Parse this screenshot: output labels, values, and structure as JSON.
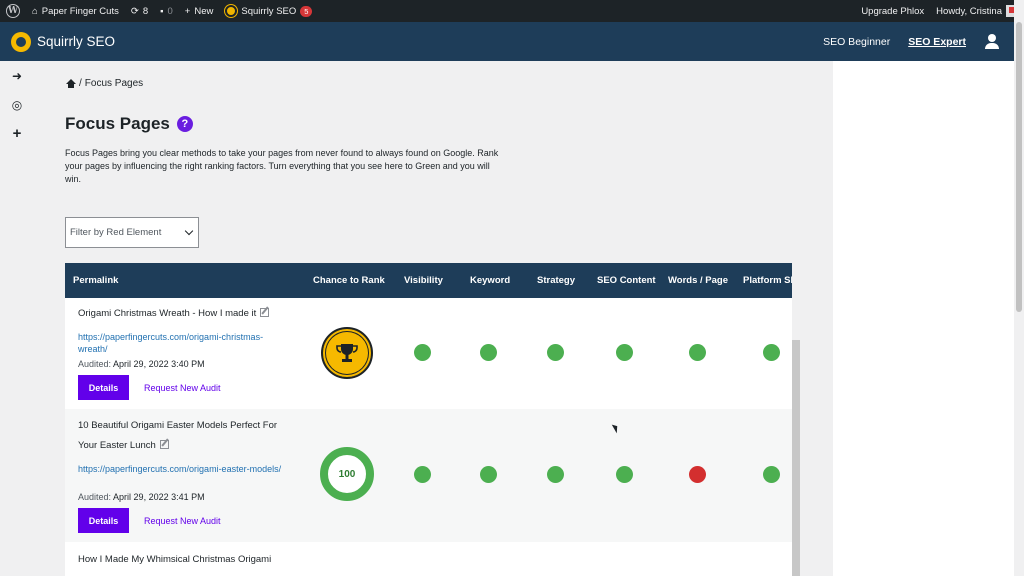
{
  "adminbar": {
    "site_name": "Paper Finger Cuts",
    "updates_count": "8",
    "comments_count": "0",
    "new_label": "New",
    "squirrly_label": "Squirrly SEO",
    "squirrly_badge": "5",
    "upgrade_label": "Upgrade Phlox",
    "howdy_label": "Howdy, Cristina"
  },
  "header": {
    "title": "Squirrly SEO",
    "nav": [
      "SEO Beginner",
      "SEO Expert"
    ]
  },
  "breadcrumb": {
    "sep": "/",
    "current": "Focus Pages"
  },
  "page": {
    "title": "Focus Pages",
    "help": "?",
    "description": "Focus Pages bring you clear methods to take your pages from never found to always found on Google. Rank your pages by influencing the right ranking factors. Turn everything that you see here to Green and you will win."
  },
  "filter": {
    "value": "Filter by Red Element"
  },
  "table": {
    "columns": [
      "Permalink",
      "Chance to Rank",
      "Visibility",
      "Keyword",
      "Strategy",
      "SEO Content",
      "Words / Page",
      "Platform SE"
    ],
    "rows": [
      {
        "title": "Origami Christmas Wreath - How I made it",
        "url": "https://paperfingercuts.com/origami-christmas-wreath/",
        "audited_label": "Audited:",
        "audited_date": "April 29, 2022 3:40 PM",
        "rank": "trophy",
        "statuses": [
          "green",
          "green",
          "green",
          "green",
          "green",
          "green"
        ]
      },
      {
        "title": "10 Beautiful Origami Easter Models Perfect For Your Easter Lunch",
        "url": "https://paperfingercuts.com/origami-easter-models/",
        "audited_label": "Audited:",
        "audited_date": "April 29, 2022 3:41 PM",
        "rank": "100",
        "statuses": [
          "green",
          "green",
          "green",
          "green",
          "red",
          "green"
        ]
      },
      {
        "title": "How I Made My Whimsical Christmas Origami"
      }
    ],
    "details_label": "Details",
    "request_audit_label": "Request New Audit"
  },
  "colors": {
    "brand": "#1e3d59",
    "accent": "#6200ea",
    "good": "#4caf50",
    "bad": "#d32f2f"
  }
}
